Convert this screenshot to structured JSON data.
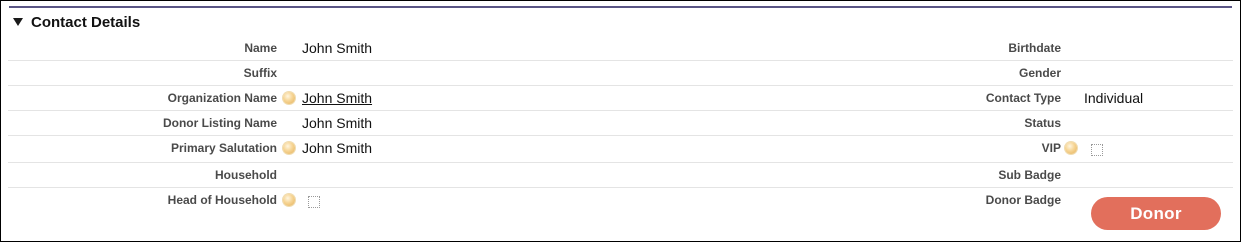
{
  "section": {
    "title": "Contact Details"
  },
  "left_fields": {
    "name": {
      "label": "Name",
      "value": "John Smith"
    },
    "suffix": {
      "label": "Suffix",
      "value": ""
    },
    "organization_name": {
      "label": "Organization Name",
      "value": "John Smith"
    },
    "donor_listing_name": {
      "label": "Donor Listing Name",
      "value": "John Smith"
    },
    "primary_salutation": {
      "label": "Primary Salutation",
      "value": "John Smith"
    },
    "household": {
      "label": "Household",
      "value": ""
    },
    "head_of_household": {
      "label": "Head of Household",
      "checked": false
    }
  },
  "right_fields": {
    "birthdate": {
      "label": "Birthdate",
      "value": ""
    },
    "gender": {
      "label": "Gender",
      "value": ""
    },
    "contact_type": {
      "label": "Contact Type",
      "value": "Individual"
    },
    "status": {
      "label": "Status",
      "value": ""
    },
    "vip": {
      "label": "VIP",
      "checked": false
    },
    "sub_badge": {
      "label": "Sub Badge",
      "value": ""
    },
    "donor_badge": {
      "label": "Donor Badge",
      "value": "Donor"
    }
  },
  "colors": {
    "badge": "#e26f5c",
    "header_rule": "#5a5585",
    "help_icon": "#f6d493"
  },
  "icons": {
    "collapse": "triangle-down-icon",
    "help": "help-icon"
  }
}
